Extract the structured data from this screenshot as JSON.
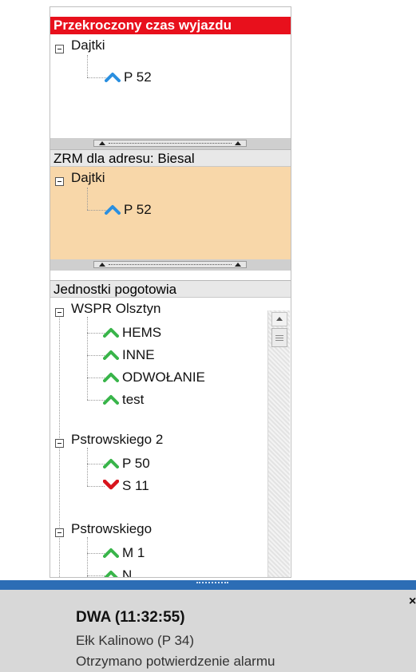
{
  "alerts_panel": {
    "header": "Przekroczony czas wyjazdu",
    "group": "Dajtki",
    "unit": "P 52"
  },
  "address_panel": {
    "header": "ZRM dla adresu: Biesal",
    "group": "Dajtki",
    "unit": "P 52"
  },
  "units_panel": {
    "header": "Jednostki pogotowia",
    "groups": [
      {
        "label": "WSPR Olsztyn",
        "items": [
          "HEMS",
          "INNE",
          "ODWOŁANIE",
          "test"
        ]
      },
      {
        "label": "Pstrowskiego 2",
        "items": [
          "P 50",
          "S 11"
        ]
      },
      {
        "label": "Pstrowskiego",
        "items": [
          "M 1",
          "N"
        ]
      }
    ]
  },
  "notification": {
    "title": "DWA (11:32:55)",
    "line1": "Ełk Kalinowo (P 34)",
    "line2": "Otrzymano potwierdzenie alarmu",
    "close": "×"
  },
  "colors": {
    "alert_header": "#e8101c",
    "highlight_bg": "#f8d7a9",
    "status_up_blue": "#2a8fe0",
    "status_up_green": "#39b54a",
    "status_down_red": "#d8141c",
    "notif_bar": "#2c6db5"
  },
  "icons": {
    "up_blue": "chevron-up-blue-icon",
    "up_green": "chevron-up-green-icon",
    "down_red": "chevron-down-red-icon"
  }
}
